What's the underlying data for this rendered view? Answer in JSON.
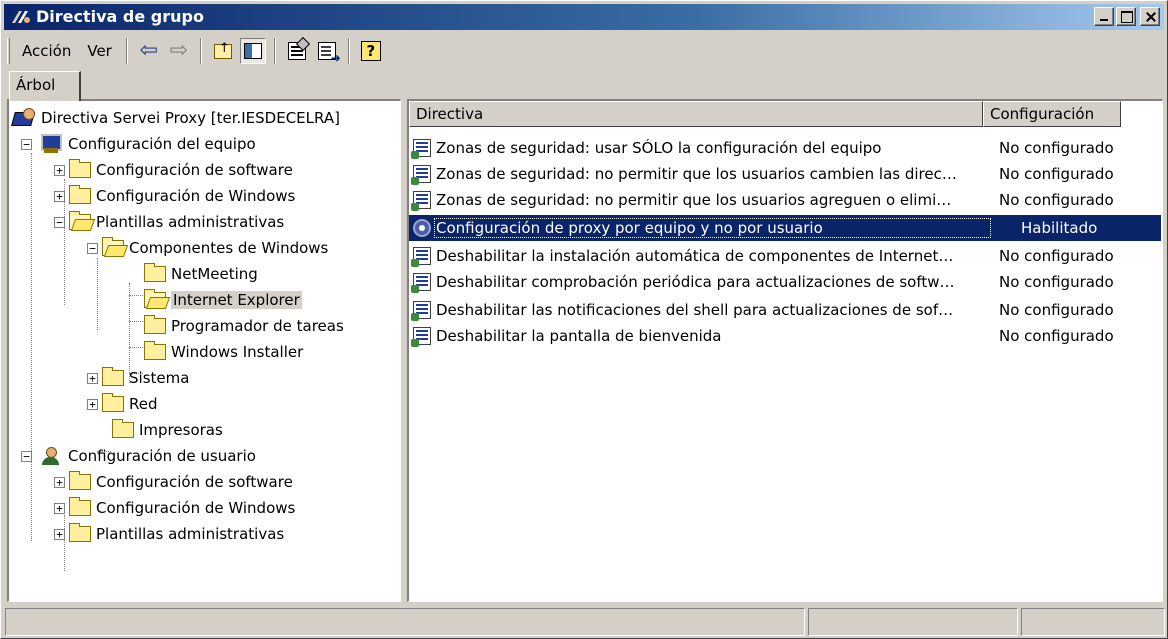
{
  "window": {
    "title": "Directiva de grupo"
  },
  "toolbar": {
    "menu_accion": "Acción",
    "menu_ver": "Ver",
    "icons": [
      "back-arrow-icon",
      "forward-arrow-icon",
      "up-folder-icon",
      "show-tree-icon",
      "properties-icon",
      "export-list-icon",
      "help-icon"
    ]
  },
  "tree_tab": {
    "label": "Árbol"
  },
  "tree": {
    "items": [
      {
        "label": "Directiva Servei Proxy [ter.IESDECELRA]"
      },
      {
        "label": "Configuración del equipo"
      },
      {
        "label": "Configuración de software"
      },
      {
        "label": "Configuración de Windows"
      },
      {
        "label": "Plantillas administrativas"
      },
      {
        "label": "Componentes de Windows"
      },
      {
        "label": "NetMeeting"
      },
      {
        "label": "Internet Explorer"
      },
      {
        "label": "Programador de tareas"
      },
      {
        "label": "Windows Installer"
      },
      {
        "label": "Sistema"
      },
      {
        "label": "Red"
      },
      {
        "label": "Impresoras"
      },
      {
        "label": "Configuración de usuario"
      },
      {
        "label": "Configuración de software"
      },
      {
        "label": "Configuración de Windows"
      },
      {
        "label": "Plantillas administrativas"
      }
    ]
  },
  "list": {
    "columns": {
      "policy": "Directiva",
      "setting": "Configuración"
    },
    "rows": [
      {
        "policy": "Zonas de seguridad: usar SÓLO la configuración del equipo",
        "setting": "No configurado"
      },
      {
        "policy": "Zonas de seguridad: no permitir que los usuarios cambien las direc…",
        "setting": "No configurado"
      },
      {
        "policy": "Zonas de seguridad: no permitir que los usuarios agreguen o elimi…",
        "setting": "No configurado"
      },
      {
        "policy": "Configuración de proxy por equipo y no por usuario",
        "setting": "Habilitado"
      },
      {
        "policy": "Deshabilitar la instalación automática de componentes de Internet…",
        "setting": "No configurado"
      },
      {
        "policy": "Deshabilitar comprobación periódica para actualizaciones de softw…",
        "setting": "No configurado"
      },
      {
        "policy": "Deshabilitar las notificaciones del shell para actualizaciones de sof…",
        "setting": "No configurado"
      },
      {
        "policy": "Deshabilitar la pantalla de bienvenida",
        "setting": "No configurado"
      }
    ]
  },
  "colors": {
    "selection": "#0a246a",
    "face": "#d4d0c8"
  }
}
